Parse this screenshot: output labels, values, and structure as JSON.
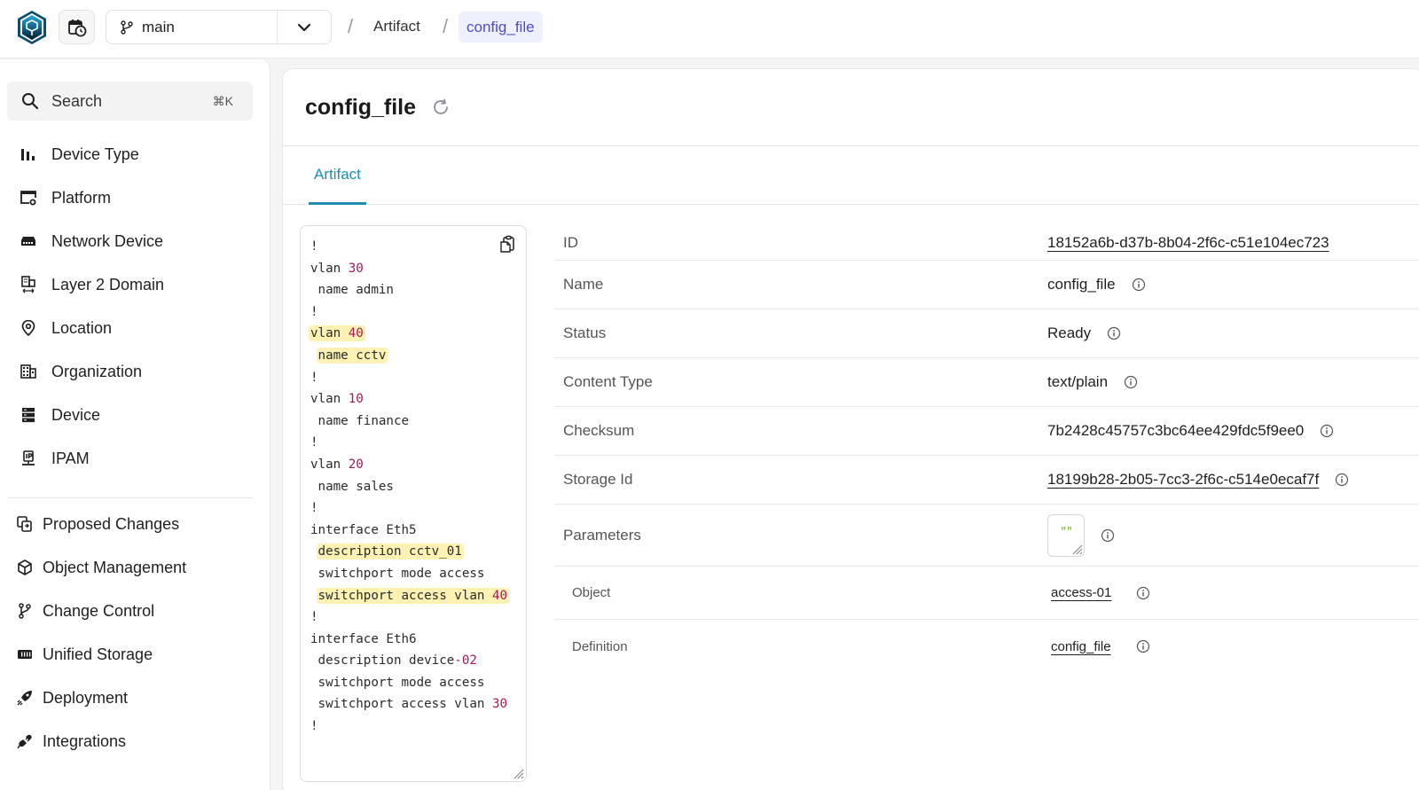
{
  "topbar": {
    "logo": "infrahub-logo-icon",
    "branch": "main",
    "breadcrumb": [
      {
        "label": "Artifact"
      },
      {
        "label": "config_file"
      }
    ],
    "separator": "/"
  },
  "sidebar": {
    "search": {
      "label": "Search",
      "shortcut": "⌘K"
    },
    "primary_items": [
      {
        "label": "Device Type",
        "icon": "bar-chart-icon"
      },
      {
        "label": "Platform",
        "icon": "platform-settings-icon"
      },
      {
        "label": "Network Device",
        "icon": "router-icon"
      },
      {
        "label": "Layer 2 Domain",
        "icon": "layer2-domain-icon"
      },
      {
        "label": "Location",
        "icon": "location-pin-icon"
      },
      {
        "label": "Organization",
        "icon": "building-icon"
      },
      {
        "label": "Device",
        "icon": "server-icon"
      },
      {
        "label": "IPAM",
        "icon": "ip-network-icon"
      }
    ],
    "secondary_items": [
      {
        "label": "Proposed Changes",
        "icon": "proposed-changes-icon"
      },
      {
        "label": "Object Management",
        "icon": "cube-icon"
      },
      {
        "label": "Change Control",
        "icon": "git-branch-icon"
      },
      {
        "label": "Unified Storage",
        "icon": "storage-icon"
      },
      {
        "label": "Deployment",
        "icon": "rocket-icon"
      },
      {
        "label": "Integrations",
        "icon": "plug-icon"
      }
    ]
  },
  "main": {
    "title": "config_file",
    "tabs": [
      {
        "label": "Artifact",
        "active": true
      }
    ],
    "code_lines": [
      {
        "parts": [
          {
            "t": "!"
          }
        ]
      },
      {
        "parts": [
          {
            "t": "vlan "
          },
          {
            "t": "30",
            "num": true
          }
        ]
      },
      {
        "parts": [
          {
            "t": " name admin"
          }
        ]
      },
      {
        "parts": [
          {
            "t": "!"
          }
        ]
      },
      {
        "hl": true,
        "parts": [
          {
            "t": "vlan "
          },
          {
            "t": "40",
            "num": true
          }
        ]
      },
      {
        "hl": true,
        "indent": true,
        "parts": [
          {
            "t": "name cctv"
          }
        ]
      },
      {
        "parts": [
          {
            "t": "!"
          }
        ]
      },
      {
        "parts": [
          {
            "t": "vlan "
          },
          {
            "t": "10",
            "num": true
          }
        ]
      },
      {
        "parts": [
          {
            "t": " name finance"
          }
        ]
      },
      {
        "parts": [
          {
            "t": "!"
          }
        ]
      },
      {
        "parts": [
          {
            "t": "vlan "
          },
          {
            "t": "20",
            "num": true
          }
        ]
      },
      {
        "parts": [
          {
            "t": " name sales"
          }
        ]
      },
      {
        "parts": [
          {
            "t": "!"
          }
        ]
      },
      {
        "parts": [
          {
            "t": "interface Eth5"
          }
        ]
      },
      {
        "hl": true,
        "indent": true,
        "parts": [
          {
            "t": "description cctv_01"
          }
        ]
      },
      {
        "parts": [
          {
            "t": " switchport mode access"
          }
        ]
      },
      {
        "hl": true,
        "indent": true,
        "parts": [
          {
            "t": "switchport access vlan "
          },
          {
            "t": "40",
            "num": true
          }
        ]
      },
      {
        "parts": [
          {
            "t": "!"
          }
        ]
      },
      {
        "parts": [
          {
            "t": "interface Eth6"
          }
        ]
      },
      {
        "parts": [
          {
            "t": " description device"
          },
          {
            "t": "-02",
            "num": true
          }
        ]
      },
      {
        "parts": [
          {
            "t": " switchport mode access"
          }
        ]
      },
      {
        "parts": [
          {
            "t": " switchport access vlan "
          },
          {
            "t": "30",
            "num": true
          }
        ]
      },
      {
        "parts": [
          {
            "t": "!"
          }
        ]
      }
    ],
    "properties": {
      "id": {
        "label": "ID",
        "value": "18152a6b-d37b-8b04-2f6c-c51e104ec723"
      },
      "name": {
        "label": "Name",
        "value": "config_file"
      },
      "status": {
        "label": "Status",
        "value": "Ready"
      },
      "content_type": {
        "label": "Content Type",
        "value": "text/plain"
      },
      "checksum": {
        "label": "Checksum",
        "value": "7b2428c45757c3bc64ee429fdc5f9ee0"
      },
      "storage_id": {
        "label": "Storage Id",
        "value": "18199b28-2b05-7cc3-2f6c-c514e0ecaf7f"
      },
      "parameters": {
        "label": "Parameters",
        "value": "\"\""
      },
      "object": {
        "label": "Object",
        "value": "access-01"
      },
      "definition": {
        "label": "Definition",
        "value": "config_file"
      }
    }
  },
  "colors": {
    "accent_tab": "#1b8fae",
    "breadcrumb_active": "#4f4bc7",
    "code_number": "#a3185a",
    "code_highlight": "#fdf2b4",
    "param_quotes": "#6aa82a"
  }
}
